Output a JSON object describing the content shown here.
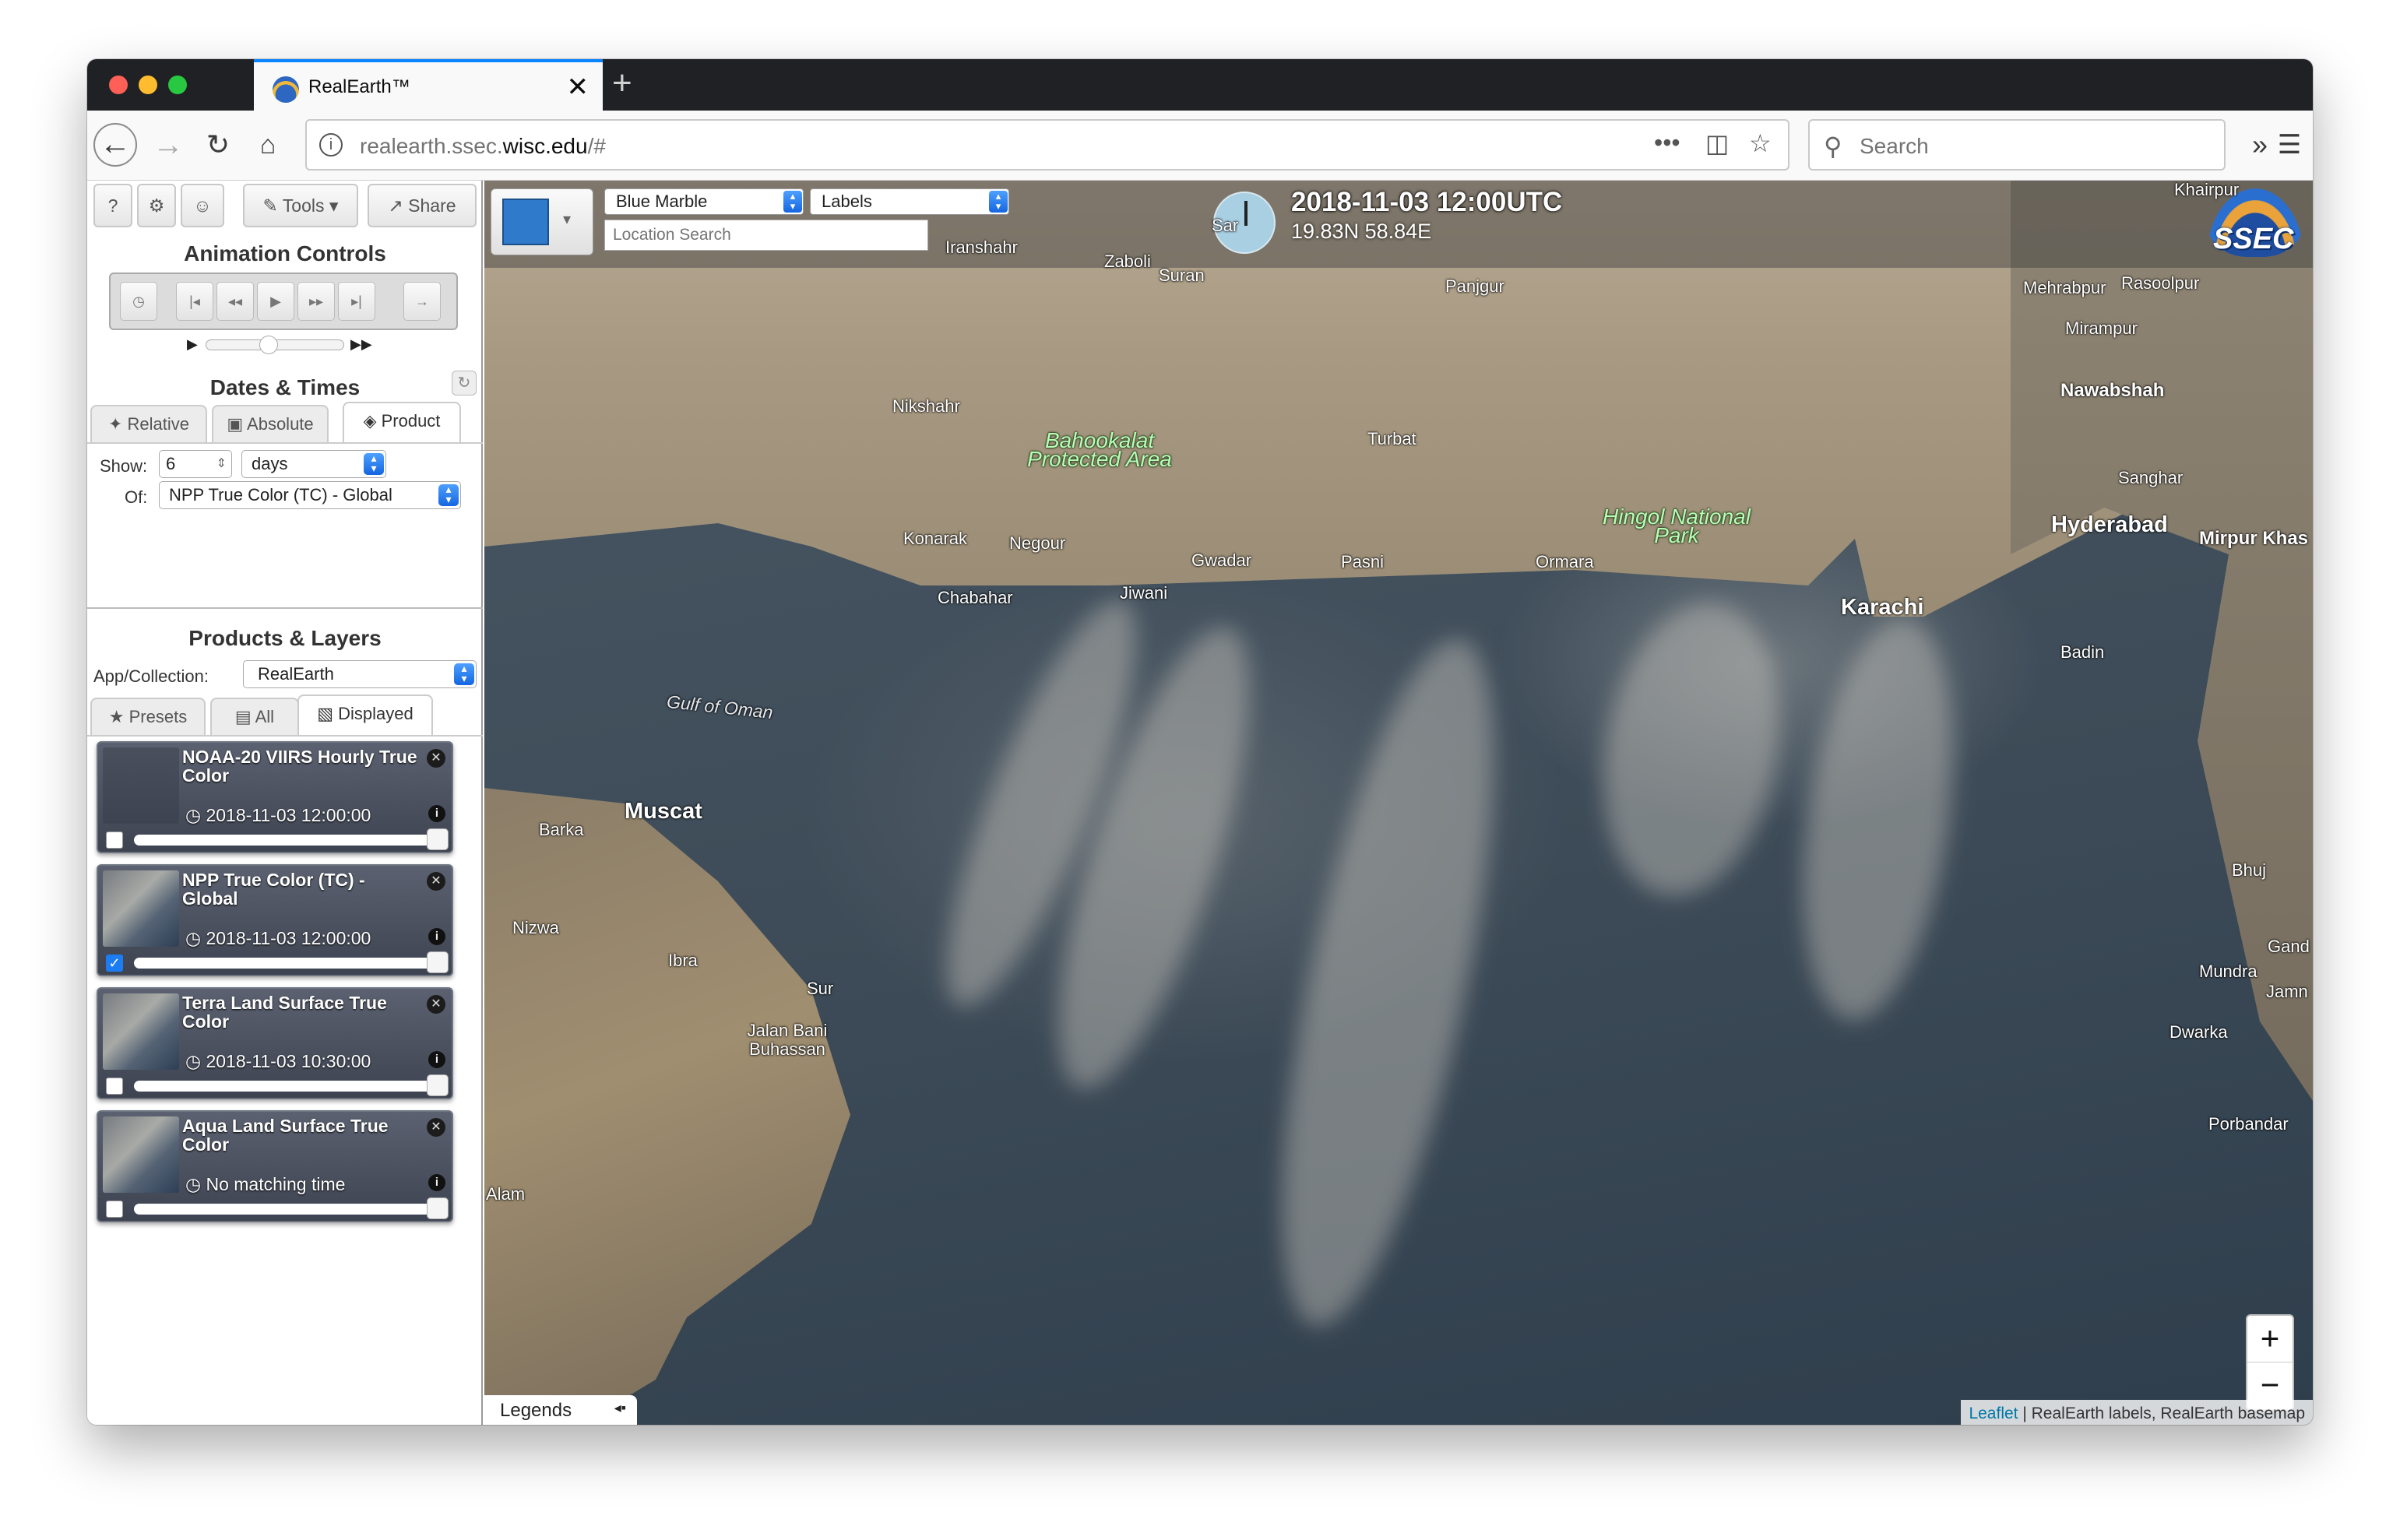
{
  "browser": {
    "tab_title": "RealEarth™",
    "tab_close": "✕",
    "new_tab": "+",
    "url_prefix": "realearth.ssec.",
    "url_domain": "wisc.edu",
    "url_suffix": "/#",
    "search_placeholder": "Search"
  },
  "sidebar": {
    "toolbar": {
      "help": "?",
      "settings": "⚙",
      "user": "👤",
      "tools": "Tools",
      "share": "Share"
    },
    "animation_title": "Animation Controls",
    "dates_title": "Dates & Times",
    "date_tabs": [
      "Relative",
      "Absolute",
      "Product"
    ],
    "show_label": "Show:",
    "show_value": "6",
    "show_unit": "days",
    "of_label": "Of:",
    "of_value": "NPP True Color (TC) - Global",
    "products_title": "Products & Layers",
    "collection_label": "App/Collection:",
    "collection_value": "RealEarth",
    "layer_tabs": [
      "Presets",
      "All",
      "Displayed"
    ],
    "layers": [
      {
        "name": "NOAA-20 VIIRS Hourly True Color",
        "time": "2018-11-03 12:00:00",
        "checked": false
      },
      {
        "name": "NPP True Color (TC) - Global",
        "time": "2018-11-03 12:00:00",
        "checked": true
      },
      {
        "name": "Terra Land Surface True Color",
        "time": "2018-11-03 10:30:00",
        "checked": false
      },
      {
        "name": "Aqua Land Surface True Color",
        "time": "No matching time",
        "checked": false
      }
    ]
  },
  "map": {
    "basemap": "Blue Marble",
    "labels": "Labels",
    "location_placeholder": "Location Search",
    "datetime": "2018-11-03 12:00UTC",
    "coords": "19.83N 58.84E",
    "logo": "SSEC",
    "zoom_in": "+",
    "zoom_out": "−",
    "legends": "Legends",
    "attribution_link": "Leaflet",
    "attribution_text": " | RealEarth labels, RealEarth basemap",
    "places": {
      "iranshahr": "Iranshahr",
      "zaboli": "Zaboli",
      "suran": "Suran",
      "sar": "Sar",
      "khairpur": "Khairpur",
      "panjgur": "Panjgur",
      "mehrabpur": "Mehrabpur",
      "rasoolpur": "Rasoolpur",
      "mirampur": "Mirampur",
      "nawabshah": "Nawabshah",
      "nikshahr": "Nikshahr",
      "bahookalat": "Bahookalat Protected Area",
      "turbat": "Turbat",
      "sanghar": "Sanghar",
      "hingol": "Hingol National Park",
      "hyderabad": "Hyderabad",
      "mirpurkhas": "Mirpur Khas",
      "konarak": "Konarak",
      "negour": "Negour",
      "gwadar": "Gwadar",
      "pasni": "Pasni",
      "ormara": "Ormara",
      "chabahar": "Chabahar",
      "jiwani": "Jiwani",
      "karachi": "Karachi",
      "badin": "Badin",
      "gulf": "Gulf of Oman",
      "muscat": "Muscat",
      "barka": "Barka",
      "nizwa": "Nizwa",
      "ibra": "Ibra",
      "sur": "Sur",
      "jalan": "Jalan Bani Buhassan",
      "bhuj": "Bhuj",
      "gand": "Gand",
      "mundra": "Mundra",
      "jamn": "Jamn",
      "dwarka": "Dwarka",
      "porbandar": "Porbandar",
      "alam": "Alam"
    }
  }
}
